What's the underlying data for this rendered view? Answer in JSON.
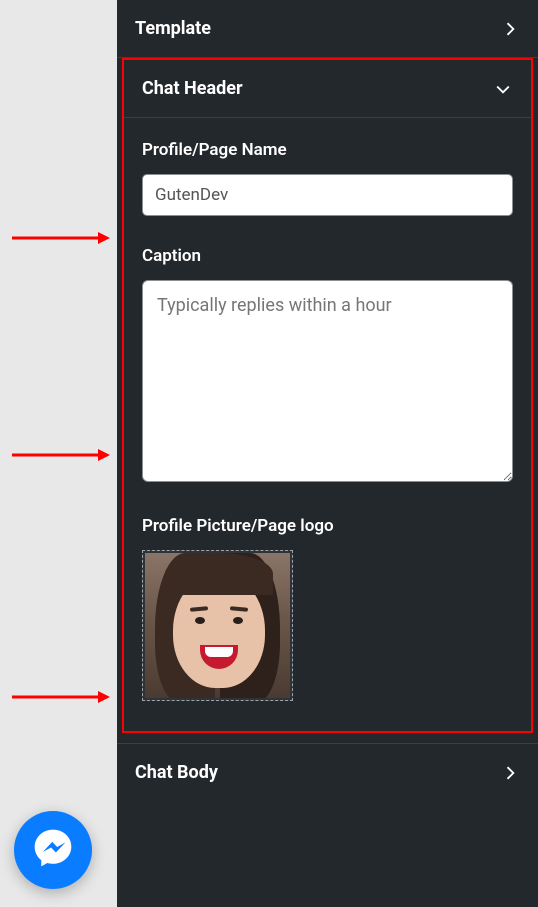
{
  "sections": {
    "template": {
      "title": "Template"
    },
    "chatHeader": {
      "title": "Chat Header",
      "profileName": {
        "label": "Profile/Page Name",
        "value": "GutenDev"
      },
      "caption": {
        "label": "Caption",
        "placeholder": "Typically replies within a hour",
        "value": ""
      },
      "profilePicture": {
        "label": "Profile Picture/Page logo"
      }
    },
    "chatBody": {
      "title": "Chat Body"
    }
  }
}
